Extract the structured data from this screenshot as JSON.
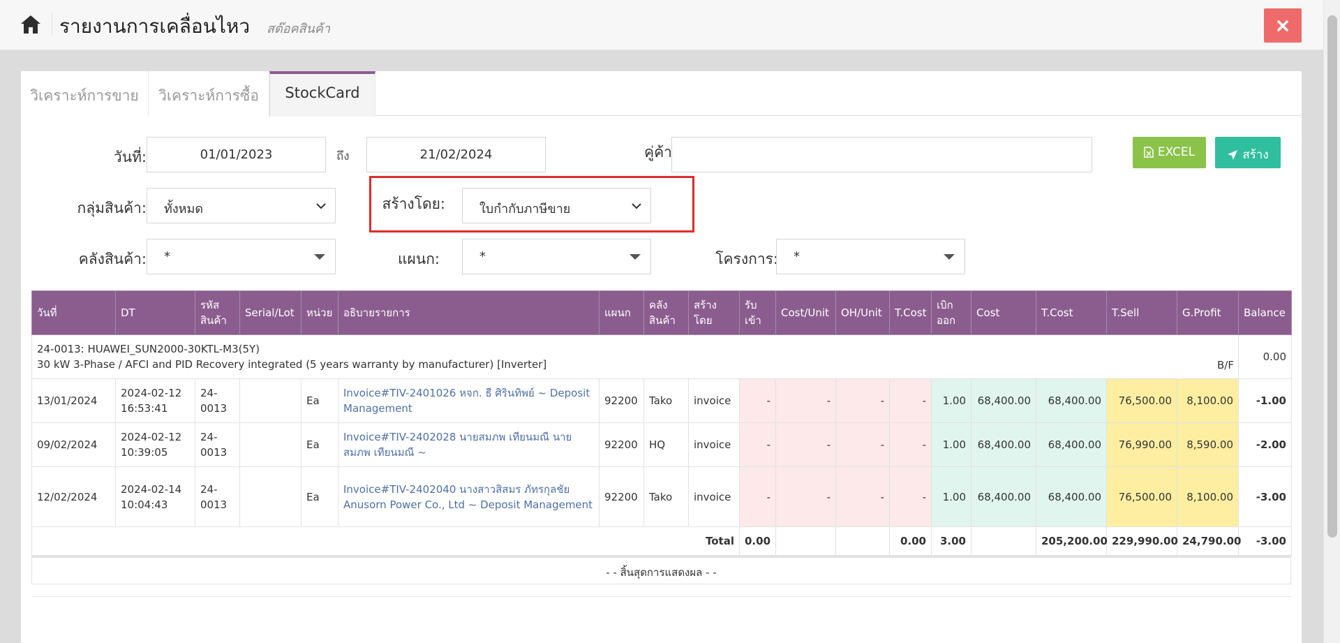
{
  "header": {
    "title": "รายงานการเคลื่อนไหว",
    "subtitle": "สต๊อคสินค้า",
    "home_icon": "home-icon",
    "close_icon": "close-icon"
  },
  "tabs": [
    {
      "label": "วิเคราะห์การขาย",
      "active": false
    },
    {
      "label": "วิเคราะห์การซื้อ",
      "active": false
    },
    {
      "label": "StockCard",
      "active": true
    }
  ],
  "filters": {
    "date_label": "วันที่:",
    "date_from": "01/01/2023",
    "to_label": "ถึง",
    "date_to": "21/02/2024",
    "partner_label": "คู่ค้า:",
    "partner_value": "",
    "product_group_label": "กลุ่มสินค้า:",
    "product_group_value": "ทั้งหมด",
    "created_by_label": "สร้างโดย:",
    "created_by_value": "ใบกำกับภาษีขาย",
    "warehouse_label": "คลังสินค้า:",
    "warehouse_value": "*",
    "department_label": "แผนก:",
    "department_value": "*",
    "project_label": "โครงการ:",
    "project_value": "*"
  },
  "buttons": {
    "excel": "EXCEL",
    "create": "สร้าง"
  },
  "table": {
    "columns": [
      "วันที่",
      "DT",
      "รหัส สินค้า",
      "Serial/Lot",
      "หน่วย",
      "อธิบายรายการ",
      "แผนก",
      "คลัง สินค้า",
      "สร้าง โดย",
      "รับ เข้า",
      "Cost/Unit",
      "OH/Unit",
      "T.Cost",
      "เบิก ออก",
      "Cost",
      "T.Cost",
      "T.Sell",
      "G.Profit",
      "Balance"
    ],
    "group": {
      "line1": "24-0013: HUAWEI_SUN2000-30KTL-M3(5Y)",
      "line2": "30 kW 3-Phase / AFCI and PID Recovery integrated (5 years warranty by manufacturer) [Inverter]",
      "bf_label": "B/F",
      "bf_value": "0.00"
    },
    "rows": [
      {
        "date": "13/01/2024",
        "dt": "2024-02-12 16:53:41",
        "code": "24-0013",
        "serial": "",
        "unit": "Ea",
        "desc": "Invoice#TIV-2401026 หจก. ธี ศิรินทิพย์ ~ Deposit Management",
        "dept": "92200",
        "wh": "Tako",
        "by": "invoice",
        "in": "-",
        "cost_unit": "-",
        "oh_unit": "-",
        "tcost_in": "-",
        "out": "1.00",
        "cost": "68,400.00",
        "tcost": "68,400.00",
        "tsell": "76,500.00",
        "gprofit": "8,100.00",
        "balance": "-1.00"
      },
      {
        "date": "09/02/2024",
        "dt": "2024-02-12 10:39:05",
        "code": "24-0013",
        "serial": "",
        "unit": "Ea",
        "desc": "Invoice#TIV-2402028 นายสมภพ เทียนมณี นาย สมภพ เทียนมณี ~",
        "dept": "92200",
        "wh": "HQ",
        "by": "invoice",
        "in": "-",
        "cost_unit": "-",
        "oh_unit": "-",
        "tcost_in": "-",
        "out": "1.00",
        "cost": "68,400.00",
        "tcost": "68,400.00",
        "tsell": "76,990.00",
        "gprofit": "8,590.00",
        "balance": "-2.00"
      },
      {
        "date": "12/02/2024",
        "dt": "2024-02-14 10:04:43",
        "code": "24-0013",
        "serial": "",
        "unit": "Ea",
        "desc": "Invoice#TIV-2402040 นางสาวสิสมร ภัทรกุลชัย Anusorn Power Co., Ltd ~ Deposit Management",
        "dept": "92200",
        "wh": "Tako",
        "by": "invoice",
        "in": "-",
        "cost_unit": "-",
        "oh_unit": "-",
        "tcost_in": "-",
        "out": "1.00",
        "cost": "68,400.00",
        "tcost": "68,400.00",
        "tsell": "76,500.00",
        "gprofit": "8,100.00",
        "balance": "-3.00"
      }
    ],
    "total": {
      "label": "Total",
      "in": "0.00",
      "tcost_in": "0.00",
      "out": "3.00",
      "tcost": "205,200.00",
      "tsell": "229,990.00",
      "gprofit": "24,790.00",
      "balance": "-3.00"
    },
    "end_text": "- - สิ้นสุดการแสดงผล - -"
  },
  "colors": {
    "header_purple": "#8b5d8f",
    "close_red": "#ef6b6b",
    "excel_green": "#8bc34a",
    "create_teal": "#2fbf9f",
    "highlight_red": "#e12b2b"
  }
}
